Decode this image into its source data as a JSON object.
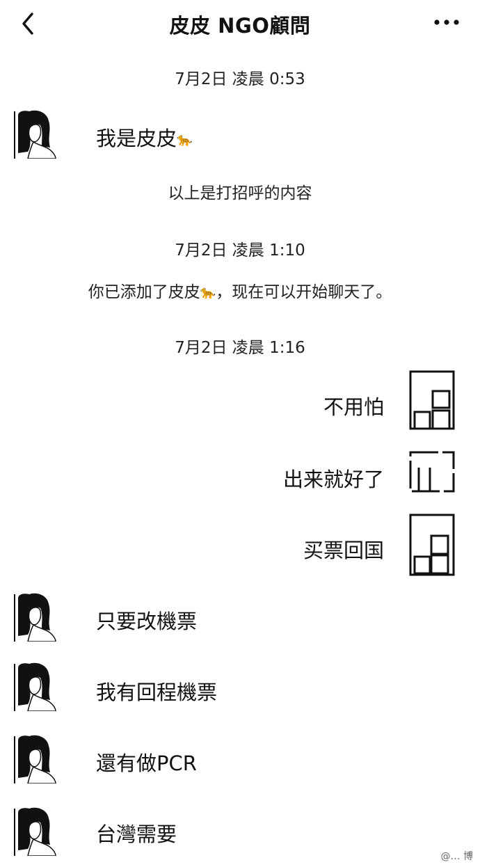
{
  "header": {
    "title": "皮皮 NGO顧問"
  },
  "messages": {
    "ts1": "7月2日 凌晨 0:53",
    "m1": "我是皮皮",
    "m1_emoji": "🐆",
    "sys1": "以上是打招呼的内容",
    "ts2": "7月2日 凌晨 1:10",
    "sys2_pre": "你已添加了皮皮",
    "sys2_emoji": "🐆",
    "sys2_post": "，现在可以开始聊天了。",
    "ts3": "7月2日 凌晨 1:16",
    "r1": "不用怕",
    "r2": "出来就好了",
    "r3": "买票回国",
    "l1": "只要改機票",
    "l2": "我有回程機票",
    "l3": "還有做PCR",
    "l4": "台灣需要"
  },
  "icons": {
    "back": "chevron-left-icon",
    "more": "more-dots-icon"
  },
  "watermark": "@… 博"
}
